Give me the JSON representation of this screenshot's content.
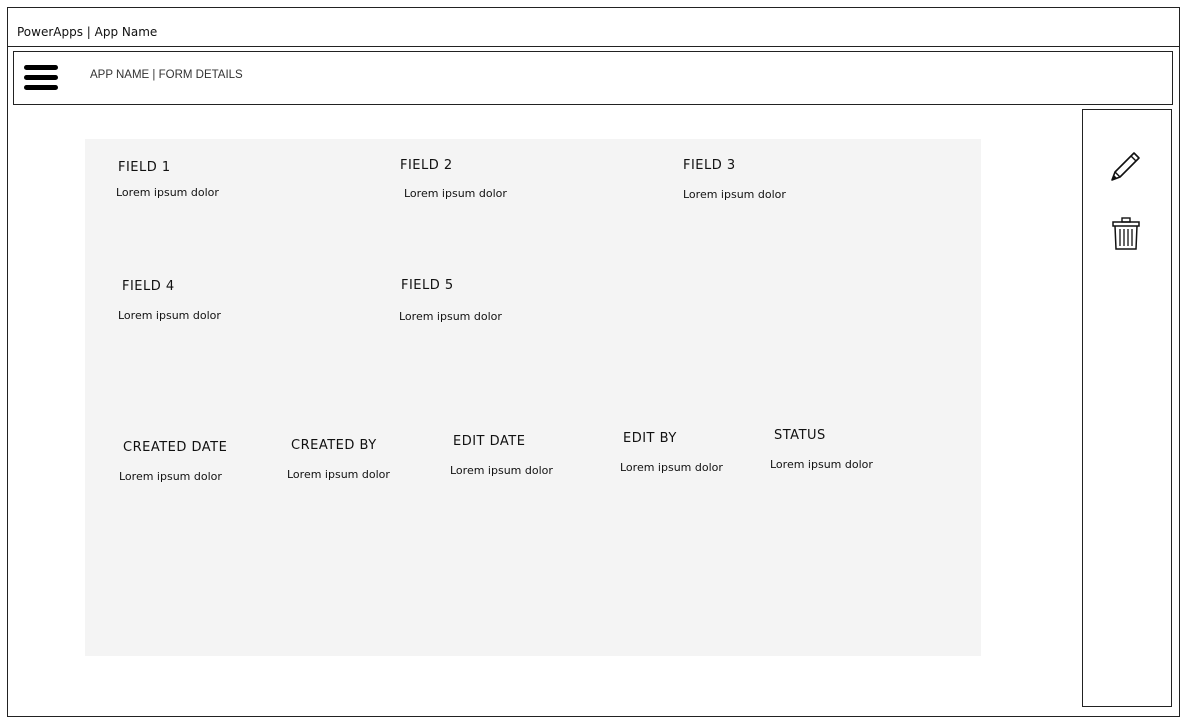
{
  "window": {
    "title": "PowerApps | App Name"
  },
  "header": {
    "title": "APP NAME | FORM DETAILS",
    "menu_icon": "hamburger-menu-icon"
  },
  "form": {
    "fields": [
      {
        "label": "FIELD 1",
        "value": "Lorem ipsum dolor"
      },
      {
        "label": "FIELD 2",
        "value": "Lorem ipsum dolor"
      },
      {
        "label": "FIELD 3",
        "value": "Lorem ipsum dolor"
      },
      {
        "label": "FIELD 4",
        "value": "Lorem ipsum dolor"
      },
      {
        "label": "FIELD 5",
        "value": "Lorem ipsum dolor"
      }
    ],
    "meta": [
      {
        "label": "CREATED DATE",
        "value": "Lorem ipsum dolor"
      },
      {
        "label": "CREATED BY",
        "value": "Lorem ipsum dolor"
      },
      {
        "label": "EDIT DATE",
        "value": "Lorem ipsum dolor"
      },
      {
        "label": "EDIT BY",
        "value": "Lorem ipsum dolor"
      },
      {
        "label": "STATUS",
        "value": "Lorem ipsum dolor"
      }
    ]
  },
  "sidebar": {
    "actions": [
      {
        "icon": "pencil-icon"
      },
      {
        "icon": "trash-icon"
      }
    ]
  }
}
